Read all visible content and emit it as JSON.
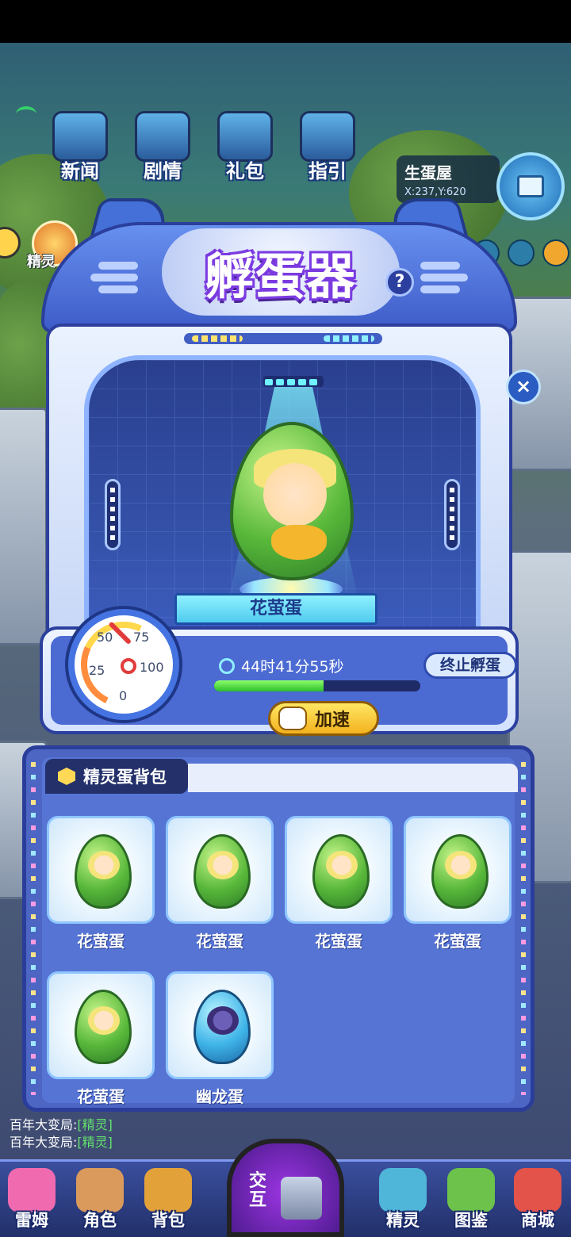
{
  "top_nav": [
    {
      "label": "新闻",
      "icon": "news-tv-icon"
    },
    {
      "label": "剧情",
      "icon": "story-device-icon"
    },
    {
      "label": "礼包",
      "icon": "gift-pack-icon"
    },
    {
      "label": "指引",
      "icon": "guide-device-icon"
    }
  ],
  "location": {
    "name": "生蛋屋",
    "coord": "X:237,Y:620"
  },
  "side_left": {
    "label": "精灵"
  },
  "incubator": {
    "title": "孵蛋器",
    "help": "?",
    "egg_name": "花萤蛋",
    "timer": "44时41分55秒",
    "progress": 0.53,
    "gauge": {
      "n0": "0",
      "n25": "25",
      "n50": "50",
      "n75": "75",
      "n100": "100"
    },
    "stop_label": "终止孵蛋",
    "speed_label": "加速"
  },
  "close": "×",
  "bag": {
    "title": "精灵蛋背包",
    "slots": [
      {
        "name": "花萤蛋",
        "type": "green"
      },
      {
        "name": "花萤蛋",
        "type": "green"
      },
      {
        "name": "花萤蛋",
        "type": "green"
      },
      {
        "name": "花萤蛋",
        "type": "green"
      },
      {
        "name": "花萤蛋",
        "type": "green"
      },
      {
        "name": "幽龙蛋",
        "type": "blue"
      }
    ]
  },
  "chat": [
    {
      "prefix": "百年大变局:",
      "tag": "[精灵]"
    },
    {
      "prefix": "百年大变局:",
      "tag": "[精灵]"
    }
  ],
  "dock": {
    "items": [
      {
        "label": "雷姆",
        "color": "#f06ab0"
      },
      {
        "label": "角色",
        "color": "#d99a5c"
      },
      {
        "label": "背包",
        "color": "#e3a13a"
      },
      {
        "label": "精灵",
        "color": "#4fb6d9"
      },
      {
        "label": "图鉴",
        "color": "#6cc24a"
      },
      {
        "label": "商城",
        "color": "#e3534a"
      }
    ],
    "center_label": "交互"
  }
}
